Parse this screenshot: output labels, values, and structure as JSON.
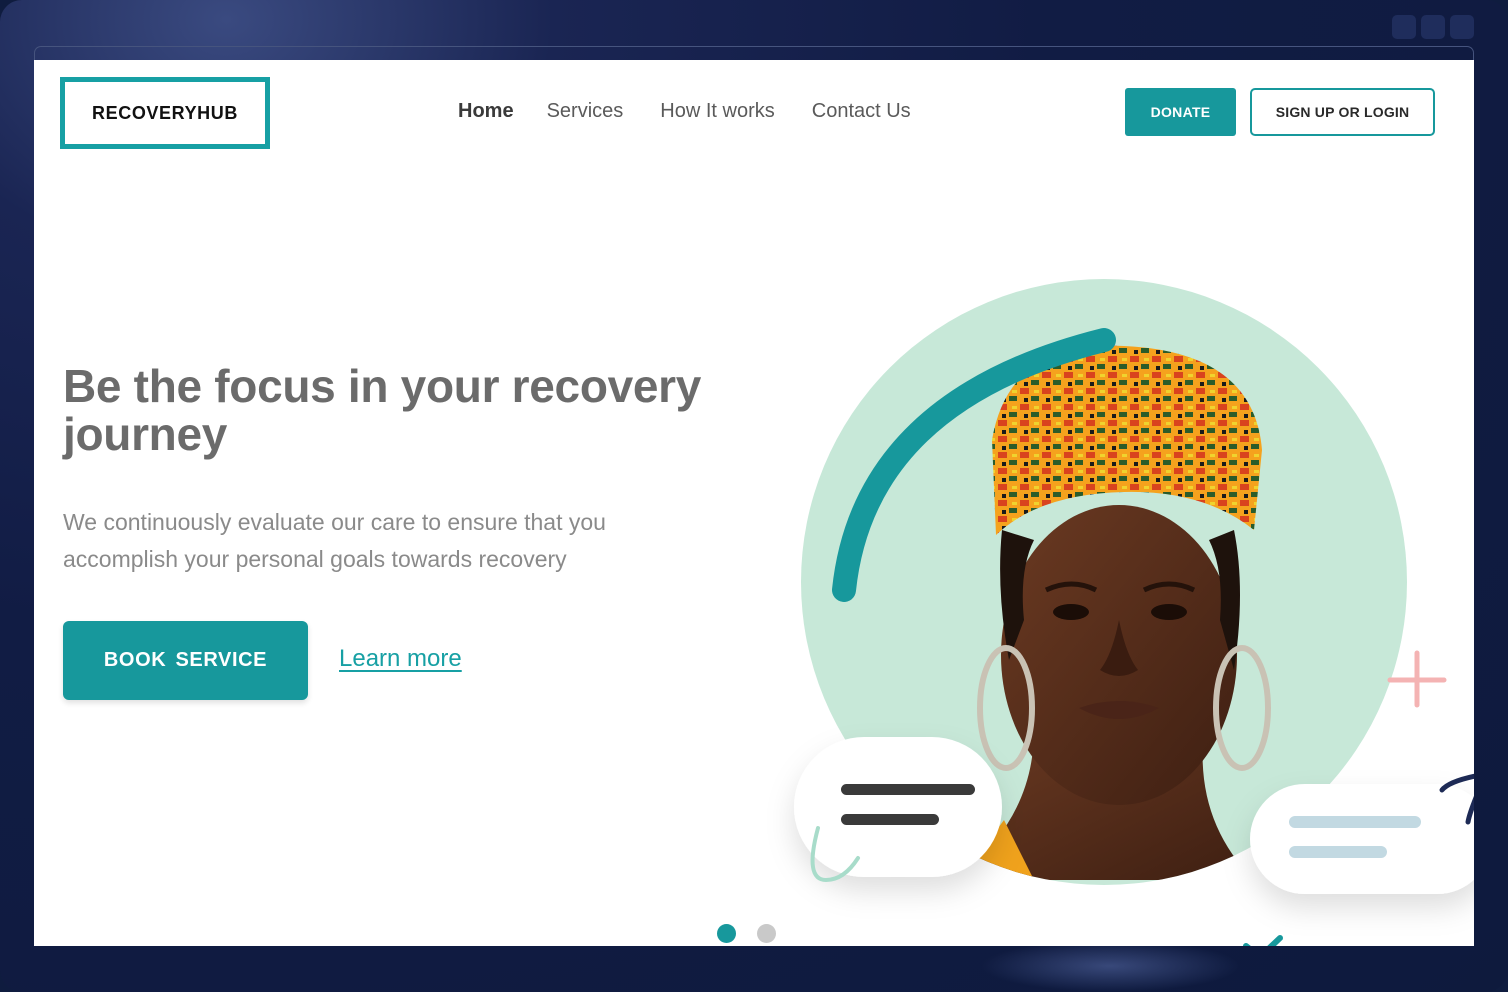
{
  "brand": {
    "logo_text": "RECOVERYHUB",
    "accent_color": "#17989c"
  },
  "nav": {
    "items": [
      {
        "label": "Home",
        "active": true
      },
      {
        "label": "Services",
        "active": false
      },
      {
        "label": "How It works",
        "active": false
      },
      {
        "label": "Contact Us",
        "active": false
      }
    ]
  },
  "header_actions": {
    "donate_label": "DONATE",
    "signup_label": "SIGN UP OR LOGIN"
  },
  "hero": {
    "headline": "Be the focus in your recovery journey",
    "subtext": "We continuously evaluate our care to ensure that you accomplish your personal goals towards recovery",
    "primary_cta": "BOOK  SERVICE",
    "secondary_link": "Learn more"
  },
  "carousel": {
    "slide_count": 2,
    "active_index": 0
  },
  "icons": [
    "window-control-icon",
    "plus-icon",
    "check-icon",
    "chat-bubble-icon",
    "arc-decoration-icon"
  ]
}
